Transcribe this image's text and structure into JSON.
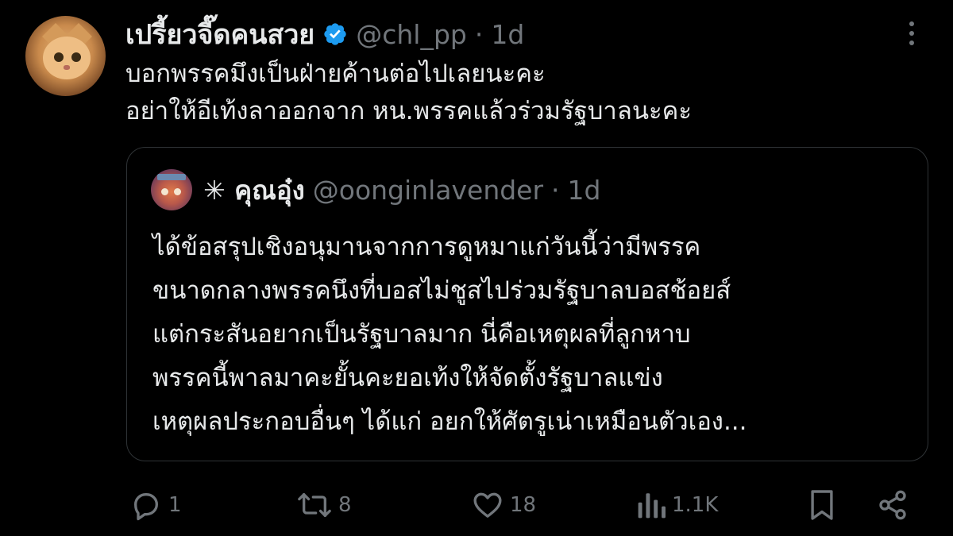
{
  "tweet": {
    "author_name": "เปรี้ยวจี๊ดคนสวย",
    "handle": "@chl_pp",
    "separator": "·",
    "time": "1d",
    "lines": [
      "บอกพรรคมึงเป็นฝ่ายค้านต่อไปเลยนะคะ",
      "อย่าให้อีเท้งลาออกจาก หน.พรรคแล้วร่วมรัฐบาลนะคะ"
    ]
  },
  "quote": {
    "author_name": "✳ คุณอุ๋ง",
    "handle": "@oonginlavender",
    "separator": "·",
    "time": "1d",
    "lines": [
      "ได้ข้อสรุปเชิงอนุมานจากการดูหมาแก่วันนี้ว่ามีพรรค",
      "ขนาดกลางพรรคนึงที่บอสไม่ชูสไปร่วมรัฐบาลบอสช้อยส์",
      "แต่กระสันอยากเป็นรัฐบาลมาก นี่คือเหตุผลที่ลูกหาบ",
      "พรรคนี้พาลมาคะยั้นคะยอเท้งให้จัดตั้งรัฐบาลแข่ง",
      "เหตุผลประกอบอื่นๆ ได้แก่ อยกให้ศัตรูเน่าเหมือนตัวเอง..."
    ]
  },
  "actions": {
    "replies": "1",
    "retweets": "8",
    "likes": "18",
    "views": "1.1K"
  },
  "icons": {
    "verified": "verified-badge-icon",
    "more": "more-options-icon",
    "reply": "reply-icon",
    "retweet": "retweet-icon",
    "like": "heart-icon",
    "views": "views-icon",
    "bookmark": "bookmark-icon",
    "share": "share-icon"
  },
  "colors": {
    "background": "#000000",
    "text": "#e7e9ea",
    "muted": "#71767b",
    "verified_blue": "#1d9bf0",
    "border": "#2f3336"
  }
}
